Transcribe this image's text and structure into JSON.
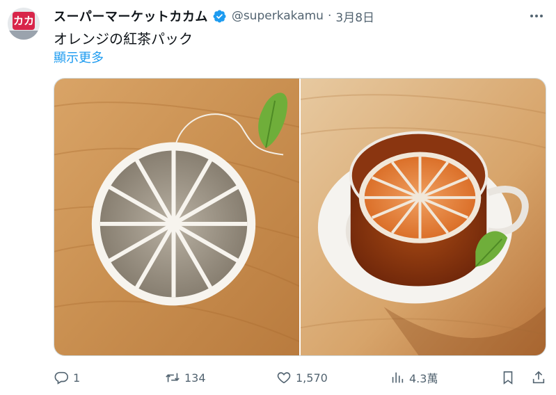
{
  "tweet": {
    "author": {
      "display_name": "スーパーマーケットカカム",
      "handle": "@superkakamu",
      "avatar_logo": "カカ",
      "verified": true
    },
    "separator": "·",
    "date": "3月8日",
    "text": "オレンジの紅茶パック",
    "show_more_label": "顯示更多",
    "media": [
      {
        "subject": "orange-slice-tea-bag-on-wood"
      },
      {
        "subject": "tea-cup-with-orange-slice-tea-bag"
      }
    ],
    "actions": {
      "replies": "1",
      "retweets": "134",
      "likes": "1,570",
      "views": "4.3萬"
    }
  },
  "colors": {
    "text_primary": "#0f1419",
    "text_secondary": "#536471",
    "link": "#1d9bf0",
    "verified_badge": "#1d9bf0",
    "border": "#cfd9de"
  },
  "icons": [
    "verified-icon",
    "more-icon",
    "reply-icon",
    "retweet-icon",
    "like-icon",
    "views-icon",
    "bookmark-icon",
    "share-icon"
  ]
}
